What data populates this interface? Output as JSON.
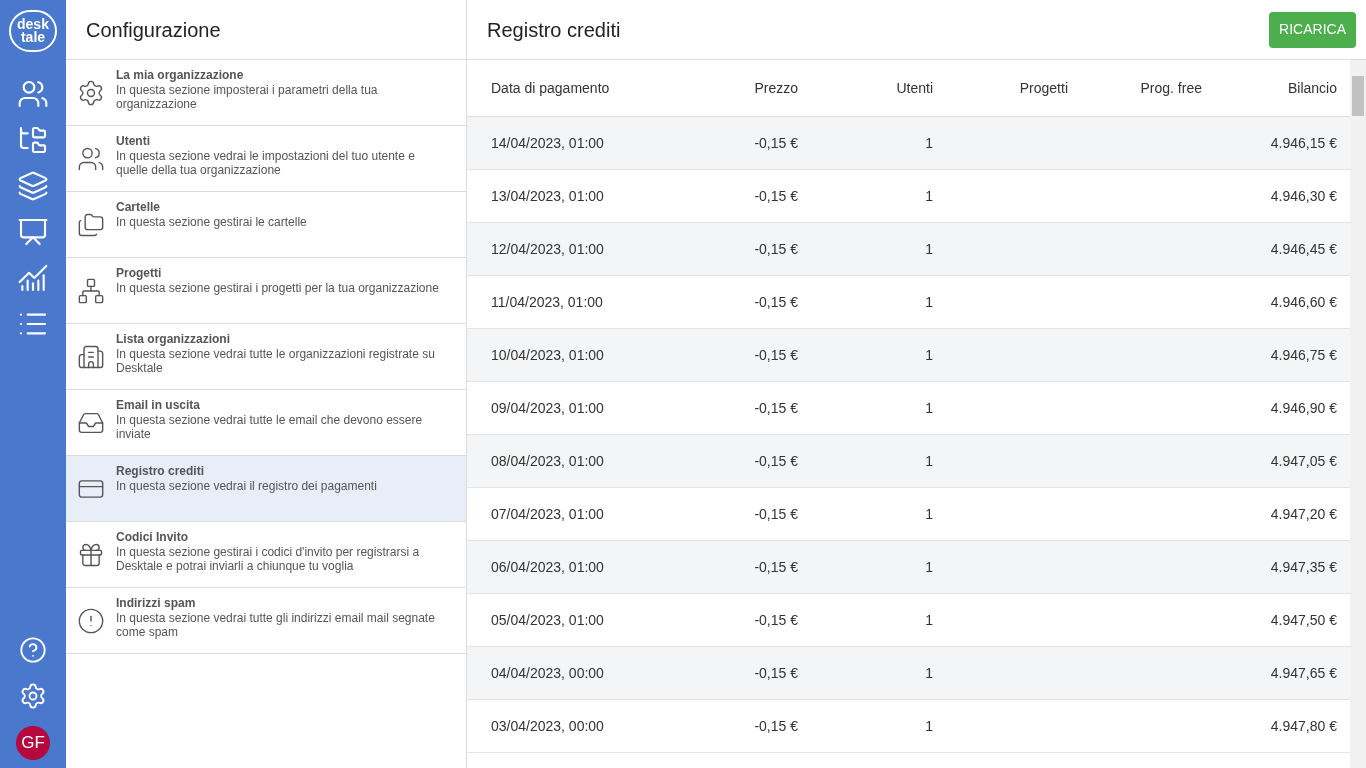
{
  "logo": {
    "line1": "desk",
    "line2": "tale"
  },
  "rail": {
    "items": [
      {
        "kind": "users"
      },
      {
        "kind": "folders"
      },
      {
        "kind": "layers"
      },
      {
        "kind": "presentation"
      },
      {
        "kind": "chart"
      },
      {
        "kind": "list"
      }
    ],
    "bottom": [
      {
        "kind": "help"
      },
      {
        "kind": "settings"
      }
    ],
    "avatar": "GF"
  },
  "config": {
    "title": "Configurazione",
    "items": [
      {
        "kind": "settings",
        "title": "La mia organizzazione",
        "description": "In questa sezione imposterai i parametri della tua organizzazione",
        "selected": false
      },
      {
        "kind": "users",
        "title": "Utenti",
        "description": "In questa sezione vedrai le impostazioni del tuo utente e quelle della tua organizzazione",
        "selected": false
      },
      {
        "kind": "folders",
        "title": "Cartelle",
        "description": "In questa sezione gestirai le cartelle",
        "selected": false
      },
      {
        "kind": "network",
        "title": "Progetti",
        "description": "In questa sezione gestirai i progetti per la tua organizzazione",
        "selected": false
      },
      {
        "kind": "organizations",
        "title": "Lista organizzazioni",
        "description": "In questa sezione vedrai tutte le organizzazioni registrate su Desktale",
        "selected": false
      },
      {
        "kind": "outbox",
        "title": "Email in uscita",
        "description": "In questa sezione vedrai tutte le email che devono essere inviate",
        "selected": false
      },
      {
        "kind": "card",
        "title": "Registro crediti",
        "description": "In questa sezione vedrai il registro dei pagamenti",
        "selected": true
      },
      {
        "kind": "gift",
        "title": "Codici Invito",
        "description": "In questa sezione gestirai i codici d'invito per registrarsi a Desktale e potrai inviarli a chiunque tu voglia",
        "selected": false
      },
      {
        "kind": "alert",
        "title": "Indirizzi spam",
        "description": "In questa sezione vedrai tutte gli indirizzi email mail segnate come spam",
        "selected": false
      }
    ]
  },
  "register": {
    "title": "Registro crediti",
    "button": "RICARICA",
    "columns": [
      "Data di pagamento",
      "Prezzo",
      "Utenti",
      "Progetti",
      "Prog. free",
      "Bilancio"
    ],
    "rows": [
      [
        "14/04/2023, 01:00",
        "-0,15 €",
        "1",
        "4.946,15 €"
      ],
      [
        "13/04/2023, 01:00",
        "-0,15 €",
        "1",
        "4.946,30 €"
      ],
      [
        "12/04/2023, 01:00",
        "-0,15 €",
        "1",
        "4.946,45 €"
      ],
      [
        "11/04/2023, 01:00",
        "-0,15 €",
        "1",
        "4.946,60 €"
      ],
      [
        "10/04/2023, 01:00",
        "-0,15 €",
        "1",
        "4.946,75 €"
      ],
      [
        "09/04/2023, 01:00",
        "-0,15 €",
        "1",
        "4.946,90 €"
      ],
      [
        "08/04/2023, 01:00",
        "-0,15 €",
        "1",
        "4.947,05 €"
      ],
      [
        "07/04/2023, 01:00",
        "-0,15 €",
        "1",
        "4.947,20 €"
      ],
      [
        "06/04/2023, 01:00",
        "-0,15 €",
        "1",
        "4.947,35 €"
      ],
      [
        "05/04/2023, 01:00",
        "-0,15 €",
        "1",
        "4.947,50 €"
      ],
      [
        "04/04/2023, 00:00",
        "-0,15 €",
        "1",
        "4.947,65 €"
      ],
      [
        "03/04/2023, 00:00",
        "-0,15 €",
        "1",
        "4.947,80 €"
      ]
    ]
  }
}
